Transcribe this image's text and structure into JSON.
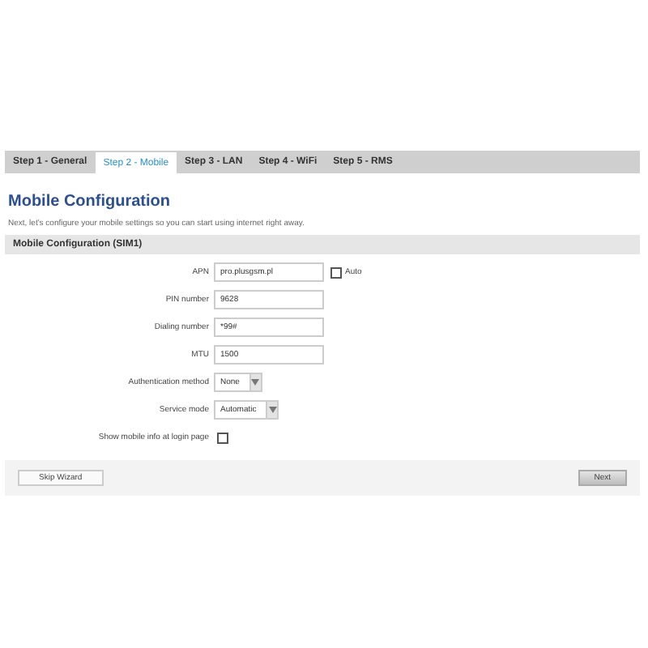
{
  "tabs": [
    {
      "label": "Step 1 - General",
      "selected": false
    },
    {
      "label": "Step 2 - Mobile",
      "selected": true
    },
    {
      "label": "Step 3 - LAN",
      "selected": false
    },
    {
      "label": "Step 4 - WiFi",
      "selected": false
    },
    {
      "label": "Step 5 - RMS",
      "selected": false
    }
  ],
  "title": "Mobile Configuration",
  "description": "Next, let's configure your mobile settings so you can start using internet right away.",
  "section": {
    "title": "Mobile Configuration (SIM1)",
    "fields": [
      {
        "kind": "text",
        "label": "APN",
        "value": "pro.plusgsm.pl",
        "checkbox": {
          "label": "Auto",
          "checked": false
        }
      },
      {
        "kind": "text",
        "label": "PIN number",
        "value": "9628"
      },
      {
        "kind": "text",
        "label": "Dialing number",
        "value": "*99#"
      },
      {
        "kind": "text",
        "label": "MTU",
        "value": "1500"
      },
      {
        "kind": "select",
        "label": "Authentication method",
        "value": "None"
      },
      {
        "kind": "select",
        "label": "Service mode",
        "value": "Automatic"
      },
      {
        "kind": "checkbox",
        "label": "Show mobile info at login page",
        "checked": false
      }
    ]
  },
  "buttons": {
    "skip": "Skip Wizard",
    "next": "Next"
  }
}
